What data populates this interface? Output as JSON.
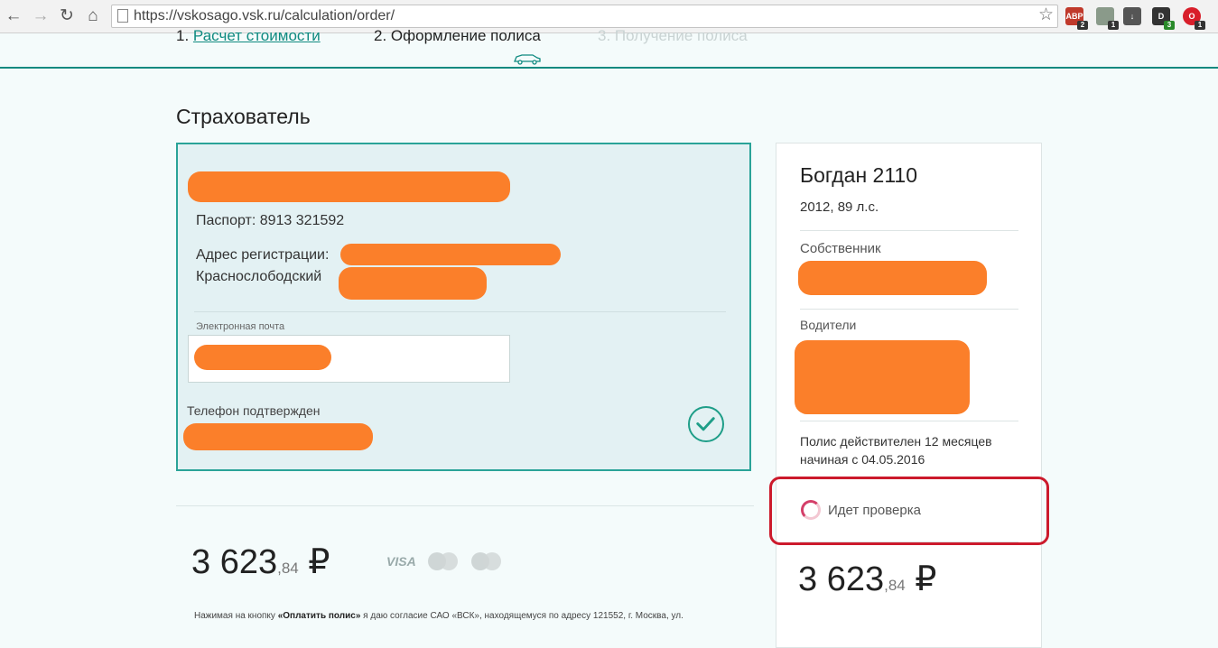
{
  "browser": {
    "url": "https://vskosago.vsk.ru/calculation/order/",
    "extensions": [
      {
        "name": "ABP",
        "badge": "2",
        "color": "#c0392b"
      },
      {
        "name": "",
        "badge": "1",
        "color": "#8a9a8a"
      },
      {
        "name": "",
        "badge": "",
        "color": "#555555"
      },
      {
        "name": "D",
        "badge": "3",
        "color": "#333333"
      },
      {
        "name": "O",
        "badge": "1",
        "color": "#d81e2a"
      }
    ]
  },
  "steps": {
    "step1_num": "1.",
    "step1_label": "Расчет стоимости",
    "step2": "2. Оформление полиса",
    "step3": "3. Получение полиса"
  },
  "insurer": {
    "title": "Страхователь",
    "passport": "Паспорт: 8913 321592",
    "address_label": "Адрес регистрации:",
    "address_city": "Краснослободский",
    "email_label": "Электронная почта",
    "phone_label": "Телефон подтвержден"
  },
  "price": {
    "rub": "3 623",
    "kop": ",84",
    "currency": "₽"
  },
  "payment": {
    "visa": "VISA",
    "mastercard": "MasterCard",
    "maestro": "Maestro"
  },
  "legal": {
    "prefix": "Нажимая на кнопку ",
    "button_name": "«Оплатить полис»",
    "suffix": " я даю согласие САО «ВСК», находящемуся по адресу 121552, г. Москва, ул."
  },
  "summary": {
    "car_title": "Богдан 2110",
    "car_details": "2012, 89 л.с.",
    "owner_label": "Собственник",
    "drivers_label": "Водители",
    "validity_line1": "Полис действителен 12 месяцев",
    "validity_line2": "начиная с 04.05.2016",
    "checking": "Идет проверка",
    "price_rub": "3 623",
    "price_kop": ",84",
    "currency": "₽"
  }
}
